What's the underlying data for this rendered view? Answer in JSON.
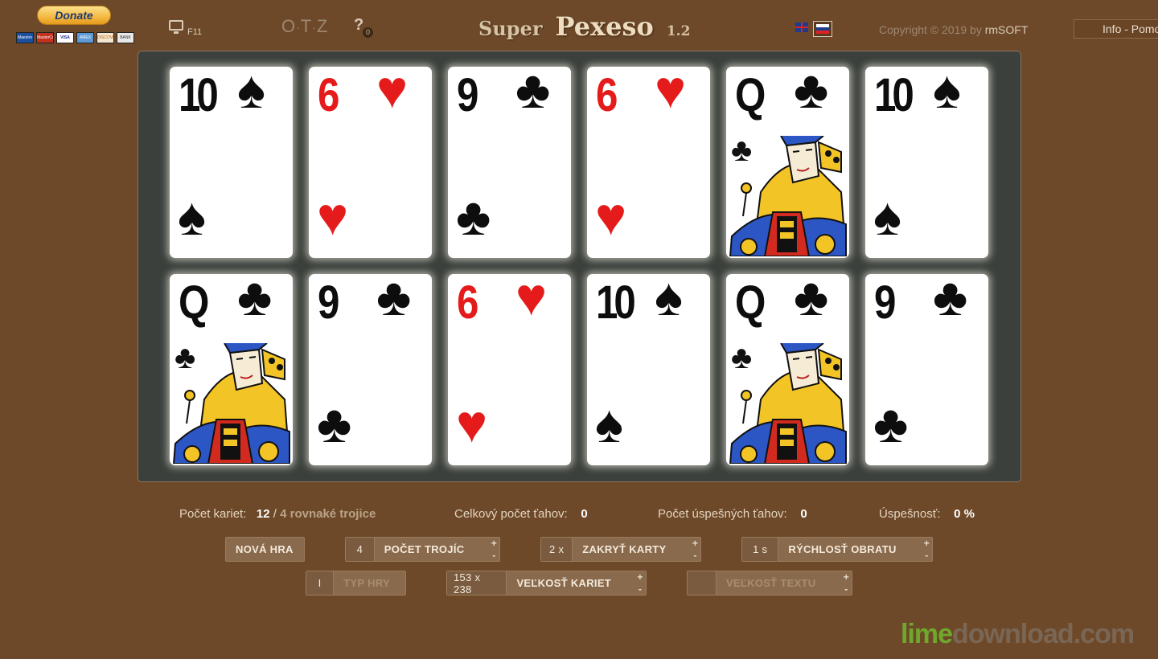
{
  "header": {
    "donate_label": "Donate",
    "payment_cards": [
      "Maestro",
      "MasterCard",
      "VISA",
      "AMEX",
      "DISCOVER",
      "BANK"
    ],
    "fullscreen_key": "F11",
    "otz_label": [
      "O",
      "T",
      "Z"
    ],
    "help_label": "?",
    "help_count": "0",
    "title_super": "Super",
    "title_main": "Pexeso",
    "version": "1.2",
    "copyright_prefix": "Copyright © 2019 by",
    "copyright_brand": "rmSOFT",
    "info_button": "Info - Pomoc"
  },
  "cards": [
    {
      "rank": "10",
      "suit": "♠",
      "color": "black",
      "face": false
    },
    {
      "rank": "6",
      "suit": "♥",
      "color": "red",
      "face": false
    },
    {
      "rank": "9",
      "suit": "♣",
      "color": "black",
      "face": false
    },
    {
      "rank": "6",
      "suit": "♥",
      "color": "red",
      "face": false
    },
    {
      "rank": "Q",
      "suit": "♣",
      "color": "black",
      "face": true
    },
    {
      "rank": "10",
      "suit": "♠",
      "color": "black",
      "face": false
    },
    {
      "rank": "Q",
      "suit": "♣",
      "color": "black",
      "face": true
    },
    {
      "rank": "9",
      "suit": "♣",
      "color": "black",
      "face": false
    },
    {
      "rank": "6",
      "suit": "♥",
      "color": "red",
      "face": false
    },
    {
      "rank": "10",
      "suit": "♠",
      "color": "black",
      "face": false
    },
    {
      "rank": "Q",
      "suit": "♣",
      "color": "black",
      "face": true
    },
    {
      "rank": "9",
      "suit": "♣",
      "color": "black",
      "face": false
    }
  ],
  "stats": {
    "card_count_label": "Počet kariet:",
    "card_count": "12",
    "card_count_sep": "/",
    "triples_link": "4 rovnaké trojice",
    "total_moves_label": "Celkový počet ťahov:",
    "total_moves": "0",
    "successful_moves_label": "Počet úspešných ťahov:",
    "successful_moves": "0",
    "success_rate_label": "Úspešnosť:",
    "success_rate": "0 %"
  },
  "controls": {
    "new_game": "NOVÁ HRA",
    "triples_value": "4",
    "triples_label": "POČET TROJÍC",
    "hide_value": "2 x",
    "hide_label": "ZAKRYŤ KARTY",
    "speed_value": "1 s",
    "speed_label": "RÝCHLOSŤ OBRATU",
    "game_type_value": "I",
    "game_type_label": "TYP HRY",
    "card_size_value": "153 x 238",
    "card_size_label": "VEĽKOSŤ KARIET",
    "text_size_value": "",
    "text_size_label": "VEĽKOSŤ TEXTU",
    "spin_plus": "+",
    "spin_minus": "-"
  },
  "watermark": {
    "lime": "lime",
    "rest": "download.com"
  },
  "colors": {
    "background": "#6e4929",
    "board": "#3c403c",
    "red_suit": "#e51b1b"
  }
}
